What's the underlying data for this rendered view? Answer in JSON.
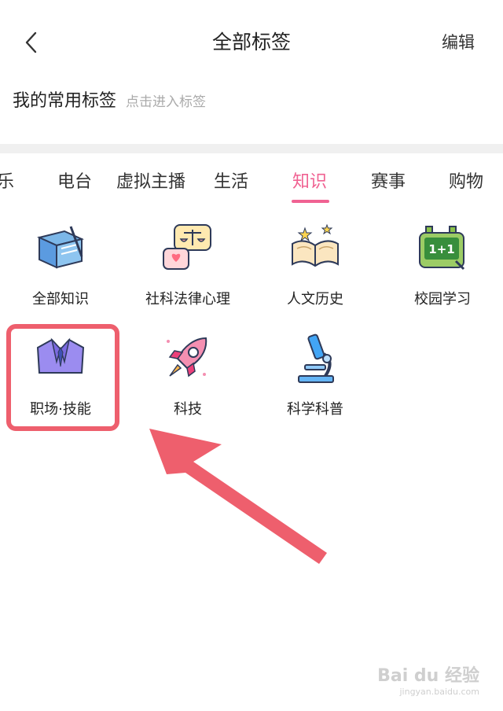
{
  "header": {
    "title": "全部标签",
    "edit_label": "编辑"
  },
  "common_tags": {
    "heading": "我的常用标签",
    "hint": "点击进入标签"
  },
  "tabs": [
    "乐",
    "电台",
    "虚拟主播",
    "生活",
    "知识",
    "赛事",
    "购物"
  ],
  "active_tab": "知识",
  "categories": [
    {
      "label": "全部知识",
      "icon": "book-icon"
    },
    {
      "label": "社科法律心理",
      "icon": "scales-chat-icon"
    },
    {
      "label": "人文历史",
      "icon": "open-book-icon"
    },
    {
      "label": "校园学习",
      "icon": "chalkboard-icon"
    },
    {
      "label": "职场·技能",
      "icon": "suit-icon"
    },
    {
      "label": "科技",
      "icon": "rocket-icon"
    },
    {
      "label": "科学科普",
      "icon": "microscope-icon"
    }
  ],
  "colors": {
    "accent": "#f06292",
    "highlight_box": "#ee5f6d",
    "arrow": "#ee5f6d"
  },
  "watermark": {
    "line1": "Bai du 经验",
    "line2": "jingyan.baidu.com"
  }
}
